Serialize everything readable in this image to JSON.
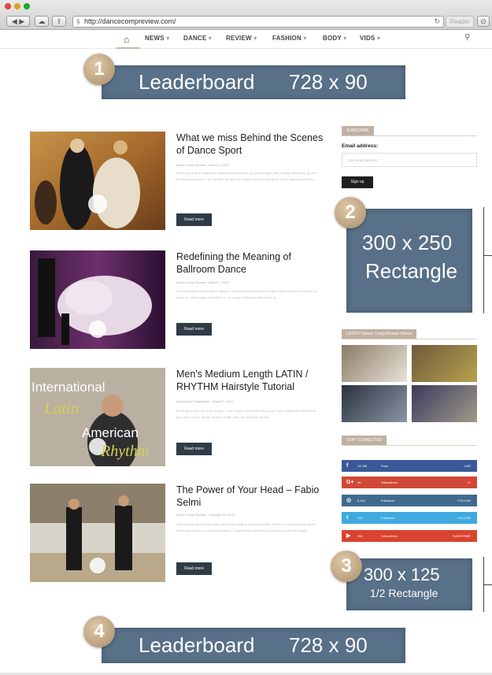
{
  "browser": {
    "url": "http://dancecompreview.com/",
    "reader_label": "Reader"
  },
  "nav": {
    "items": [
      {
        "label": "NEWS",
        "caret": "▾"
      },
      {
        "label": "DANCE",
        "caret": "▾"
      },
      {
        "label": "REVIEW",
        "caret": "▾"
      },
      {
        "label": "FASHION",
        "caret": "▾"
      },
      {
        "label": "BODY",
        "caret": "▾"
      },
      {
        "label": "VIDS",
        "caret": "▾"
      }
    ]
  },
  "ads": {
    "top": {
      "badge": "1",
      "name": "Leaderboard",
      "size": "728 x 90"
    },
    "rect": {
      "badge": "2",
      "line1": "300 x 250",
      "line2": "Rectangle"
    },
    "half": {
      "badge": "3",
      "line1": "300 x 125",
      "line2": "1/2 Rectangle"
    },
    "bottom": {
      "badge": "4",
      "name": "Leaderboard",
      "size": "728 x 90"
    }
  },
  "articles": [
    {
      "title": "What we miss Behind the Scenes of Dance Sport",
      "meta": "Dance Comp Review · March 6, 2016",
      "excerpt": "When you're at a competitive ballroom dance event, all your thoughts and energy, most likely, go into the final performance. In that state of mind, we rarely notice the beauty of what's happening behind...",
      "button": "Read more"
    },
    {
      "title": "Redefining the Meaning of Ballroom Dance",
      "meta": "Dance Comp Review · March 7, 2016",
      "excerpt": "It is fascinating how formative dance is. How it transcends the five letters that constitute it to teach us about so many things. And here it is, as a way to discover otherness, to...",
      "button": "Read more"
    },
    {
      "title": "Men's Medium Length LATIN / RHYTHM Hairstyle Tutorial",
      "meta": "DanceSport Fashionista · March 5, 2016",
      "excerpt": "It's all about that cut! In the books - a lot of dance sport men would say. If you finally have decided to grow your hair to, about, medium length, then this hairstyle tutorial...",
      "button": "Read more"
    },
    {
      "title": "The Power of Your Head – Fabio Selmi",
      "meta": "Dance Comp Review · February 29, 2016",
      "excerpt": "Just a known fact: An average man's head weights about 6kg (11lb). When it comes to Dance Sport, where your body is in constant motion, it is absolutely essential to know how to use it's weight...",
      "button": "Read more"
    }
  ],
  "sidebar": {
    "subscribe_head": "SUBSCRIBE",
    "email_label": "Email address:",
    "email_placeholder": "Your email address",
    "signup": "Sign up",
    "videos_head": "LATEST Dance Comp Review Videos",
    "stay_head": "STAY CONNECTED",
    "social": [
      {
        "icon": "f",
        "count": "14,798",
        "label": "Fans",
        "action": "LIKE",
        "color": "#3b5998"
      },
      {
        "icon": "G+",
        "count": "46",
        "label": "Subscribers",
        "action": "+1",
        "color": "#d14836"
      },
      {
        "icon": "◎",
        "count": "8,144",
        "label": "Followers",
        "action": "FOLLOW",
        "color": "#3f6a8f"
      },
      {
        "icon": "t",
        "count": "372",
        "label": "Followers",
        "action": "FOLLOW",
        "color": "#3fa9e0"
      },
      {
        "icon": "▶",
        "count": "394",
        "label": "Subscribers",
        "action": "SUBSCRIBE",
        "color": "#d9432f"
      }
    ]
  },
  "image_text": {
    "international": "International",
    "latin": "Latin",
    "american": "American",
    "rhythm": "Rhythm"
  }
}
